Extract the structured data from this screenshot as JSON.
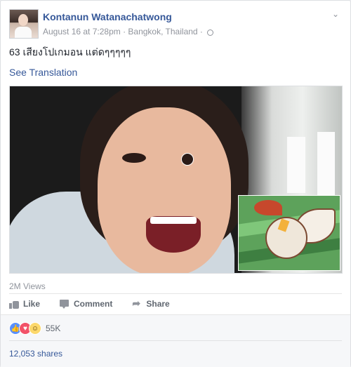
{
  "post": {
    "author": "Kontanun Watanachatwong",
    "meta": "August 16 at 7:28pm · Bangkok, Thailand ·",
    "privacy_icon": "globe-icon",
    "text": "63 เสียงโปเกมอน แต่ดๆๆๆๆๆ",
    "see_translation": "See Translation"
  },
  "video": {
    "views": "2M Views"
  },
  "actions": {
    "like": "Like",
    "comment": "Comment",
    "share": "Share"
  },
  "reactions": {
    "icons": [
      "like-icon",
      "love-icon",
      "haha-icon"
    ],
    "count": "55K"
  },
  "shares": "12,053 shares",
  "colors": {
    "link": "#365899",
    "meta": "#90949c",
    "bg": "#e9ebee"
  }
}
